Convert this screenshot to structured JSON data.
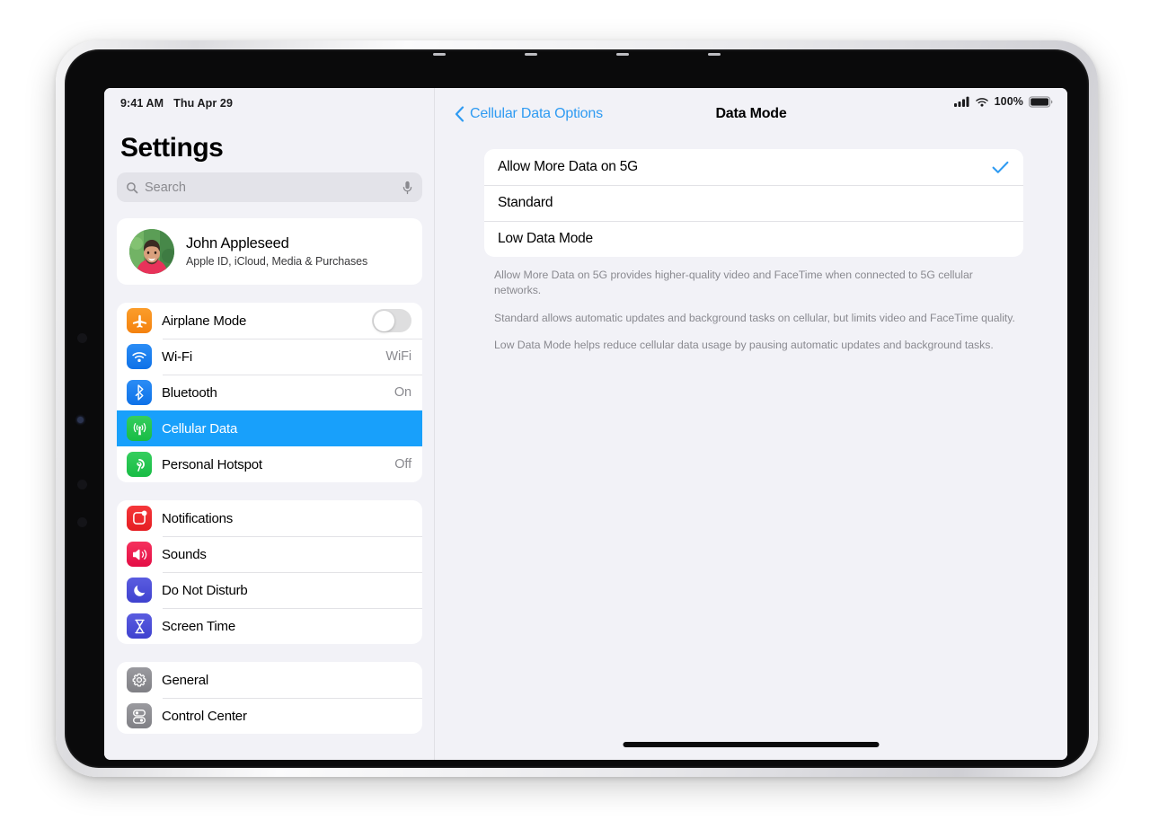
{
  "status_bar": {
    "time": "9:41 AM",
    "date": "Thu Apr 29",
    "battery_percent": "100%",
    "signal_icon": "cellular-signal-icon",
    "wifi_icon": "wifi-icon",
    "battery_icon": "battery-full-icon"
  },
  "sidebar": {
    "title": "Settings",
    "search": {
      "placeholder": "Search",
      "value": "",
      "icon": "search-icon",
      "mic_icon": "microphone-icon"
    },
    "profile": {
      "name": "John Appleseed",
      "subtitle": "Apple ID, iCloud, Media & Purchases",
      "avatar_icon": "avatar"
    },
    "groups": [
      {
        "items": [
          {
            "label": "Airplane Mode",
            "icon": "airplane-icon",
            "icon_color": "#f4820f",
            "control": "toggle",
            "toggle_on": false,
            "value": ""
          },
          {
            "label": "Wi-Fi",
            "icon": "wifi-icon",
            "icon_color": "#0f72e8",
            "control": "value",
            "value": "WiFi"
          },
          {
            "label": "Bluetooth",
            "icon": "bluetooth-icon",
            "icon_color": "#0f72e8",
            "control": "value",
            "value": "On"
          },
          {
            "label": "Cellular Data",
            "icon": "cellular-antenna-icon",
            "icon_color": "#18bc45",
            "control": "none",
            "value": "",
            "selected": true
          },
          {
            "label": "Personal Hotspot",
            "icon": "hotspot-icon",
            "icon_color": "#18bc45",
            "control": "value",
            "value": "Off"
          }
        ]
      },
      {
        "items": [
          {
            "label": "Notifications",
            "icon": "notifications-icon",
            "icon_color": "#e51d22",
            "control": "none",
            "value": ""
          },
          {
            "label": "Sounds",
            "icon": "sounds-icon",
            "icon_color": "#e40d45",
            "control": "none",
            "value": ""
          },
          {
            "label": "Do Not Disturb",
            "icon": "moon-icon",
            "icon_color": "#3f42cf",
            "control": "none",
            "value": ""
          },
          {
            "label": "Screen Time",
            "icon": "hourglass-icon",
            "icon_color": "#3f42cf",
            "control": "none",
            "value": ""
          }
        ]
      },
      {
        "items": [
          {
            "label": "General",
            "icon": "gear-icon",
            "icon_color": "#808085",
            "control": "none",
            "value": ""
          },
          {
            "label": "Control Center",
            "icon": "control-center-icon",
            "icon_color": "#808085",
            "control": "none",
            "value": ""
          }
        ]
      }
    ]
  },
  "detail": {
    "back_label": "Cellular Data Options",
    "back_icon": "chevron-left-icon",
    "title": "Data Mode",
    "options": [
      {
        "label": "Allow More Data on 5G",
        "selected": true
      },
      {
        "label": "Standard",
        "selected": false
      },
      {
        "label": "Low Data Mode",
        "selected": false
      }
    ],
    "check_icon": "checkmark-icon",
    "footnotes": [
      "Allow More Data on 5G provides higher-quality video and FaceTime when connected to 5G cellular networks.",
      "Standard allows automatic updates and background tasks on cellular, but limits video and FaceTime quality.",
      "Low Data Mode helps reduce cellular data usage by pausing automatic updates and background tasks."
    ]
  },
  "colors": {
    "accent_blue": "#2f9bf2",
    "selected_row": "#18a0fb",
    "background": "#f2f2f7"
  }
}
